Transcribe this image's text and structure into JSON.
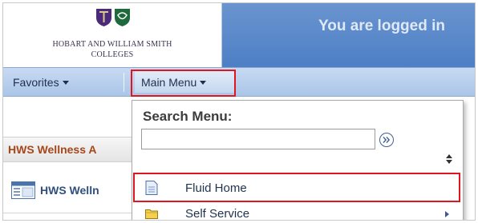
{
  "header": {
    "logo_line1": "HOBART AND WILLIAM SMITH",
    "logo_line2": "COLLEGES",
    "logged_in_text": "You are logged in"
  },
  "nav": {
    "favorites_label": "Favorites",
    "main_menu_label": "Main Menu"
  },
  "page": {
    "section_title": "HWS Wellness A",
    "link_label": "HWS Welln"
  },
  "menu": {
    "search_label": "Search Menu:",
    "search_value": "",
    "items": [
      {
        "label": "Fluid Home",
        "icon": "document-icon",
        "has_submenu": false
      },
      {
        "label": "Self Service",
        "icon": "folder-icon",
        "has_submenu": true
      }
    ]
  },
  "colors": {
    "header_blue": "#5583c9",
    "nav_blue": "#b7cfee",
    "highlight_red": "#e0151d",
    "section_title": "#a5471a",
    "hobart_purple": "#4b2a7c",
    "smith_green": "#1e6a3c"
  }
}
